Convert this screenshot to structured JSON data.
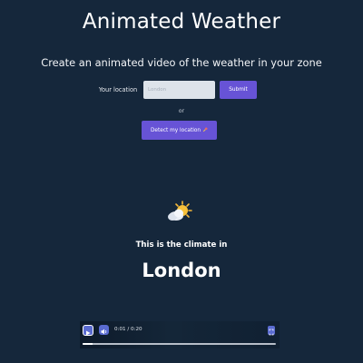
{
  "header": {
    "title": "Animated Weather",
    "subtitle": "Create an animated video of the weather in your zone"
  },
  "form": {
    "location_label": "Your location",
    "location_placeholder": "London",
    "location_value": "",
    "submit_label": "Submit",
    "or_text": "or",
    "detect_label": "Detect my location"
  },
  "result": {
    "weather_icon": "sun-behind-cloud-icon",
    "climate_text": "This is the climate in",
    "city": "London"
  },
  "player": {
    "time_display": "0:01 / 0:20",
    "progress": 0.05,
    "play_icon": "play-icon",
    "volume_icon": "volume-icon",
    "fullscreen_icon": "fullscreen-icon"
  },
  "colors": {
    "background": "#15273b",
    "accent": "#6753d6",
    "player_button": "#5a6bd0"
  }
}
